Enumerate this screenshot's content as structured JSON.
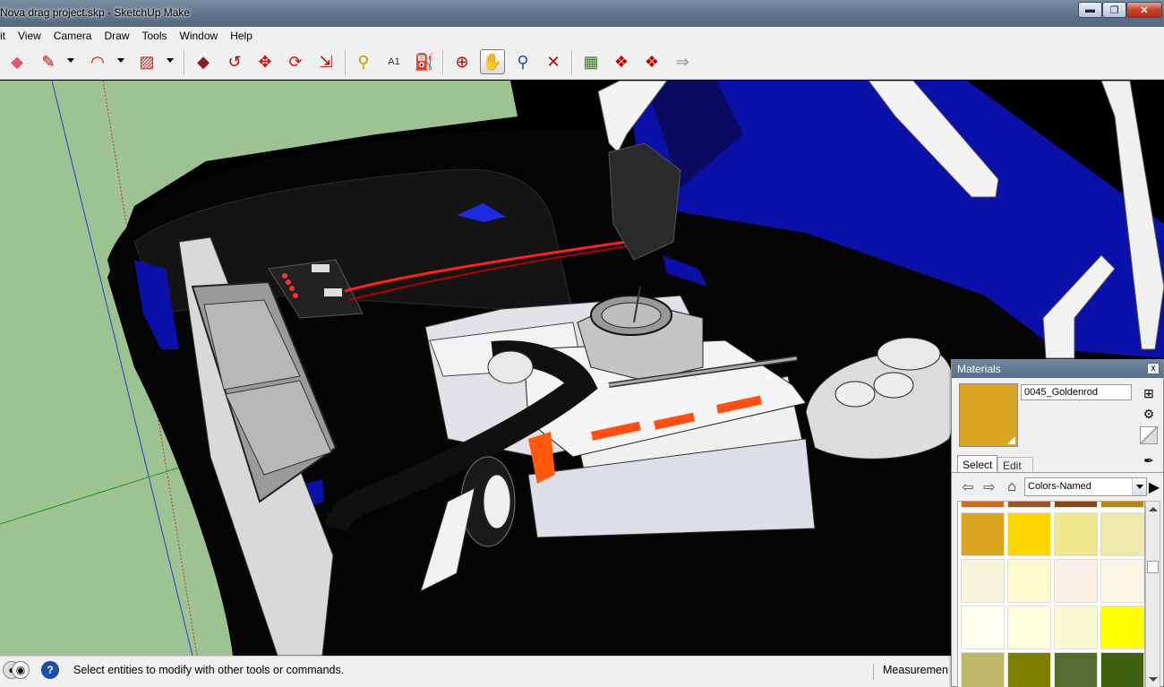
{
  "window": {
    "title": "Nova drag project.skp - SketchUp Make",
    "minimize": "▬",
    "maximize": "❐",
    "close": "✕"
  },
  "menu": [
    "it",
    "View",
    "Camera",
    "Draw",
    "Tools",
    "Window",
    "Help"
  ],
  "toolbar": {
    "tools": [
      {
        "name": "eraser-icon",
        "glyph": "◆",
        "color": "#e05570"
      },
      {
        "name": "pencil-icon",
        "glyph": "✎",
        "color": "#c00000"
      },
      {
        "name": "arc-icon",
        "glyph": "◠",
        "color": "#c00000"
      },
      {
        "name": "rectangle-icon",
        "glyph": "▨",
        "color": "#b03030"
      },
      {
        "name": "push-pull-icon",
        "glyph": "◆",
        "color": "#8b2020"
      },
      {
        "name": "follow-me-icon",
        "glyph": "↺",
        "color": "#c00000"
      },
      {
        "name": "move-icon",
        "glyph": "✥",
        "color": "#d01010"
      },
      {
        "name": "rotate-icon",
        "glyph": "⟳",
        "color": "#d01010"
      },
      {
        "name": "scale-icon",
        "glyph": "⇲",
        "color": "#c00000"
      },
      {
        "name": "tape-measure-icon",
        "glyph": "⚲",
        "color": "#c59a00"
      },
      {
        "name": "text-icon",
        "glyph": "A1",
        "color": "#333333"
      },
      {
        "name": "paint-bucket-icon",
        "glyph": "⛽",
        "color": "#c68a00"
      },
      {
        "name": "orbit-icon",
        "glyph": "⊕",
        "color": "#c00000"
      },
      {
        "name": "pan-icon",
        "glyph": "✋",
        "color": "#333333"
      },
      {
        "name": "zoom-icon",
        "glyph": "⚲",
        "color": "#2050a0"
      },
      {
        "name": "zoom-extents-icon",
        "glyph": "✕",
        "color": "#c00000"
      },
      {
        "name": "add-location-icon",
        "glyph": "▦",
        "color": "#3a7a2a"
      },
      {
        "name": "3d-warehouse-icon",
        "glyph": "❖",
        "color": "#c00000"
      },
      {
        "name": "share-model-icon",
        "glyph": "❖",
        "color": "#c00000"
      },
      {
        "name": "share-component-icon",
        "glyph": "⇒",
        "color": "#999999"
      }
    ]
  },
  "status": {
    "message": "Select entities to modify with other tools or commands.",
    "measurements_label": "Measuremen",
    "help_icon": "?"
  },
  "materials": {
    "panel_title": "Materials",
    "close": "x",
    "current_name": "0045_Goldenrod",
    "current_color": "#DAA520",
    "tabs": [
      "Select",
      "Edit"
    ],
    "library": "Colors-Named",
    "swatches": [
      "#D2691E",
      "#A0522D",
      "#8B4513",
      "#B8860B",
      "#DAA520",
      "#FFD700",
      "#F0E68C",
      "#EEE8AA",
      "#F5F5DC",
      "#FFFACD",
      "#FAF0E6",
      "#FDF5E6",
      "#FFFFF0",
      "#FFFFE0",
      "#FAFAD2",
      "#FFFF00",
      "#BDB76B",
      "#808000",
      "#556B2F",
      "#3E5F10"
    ]
  }
}
